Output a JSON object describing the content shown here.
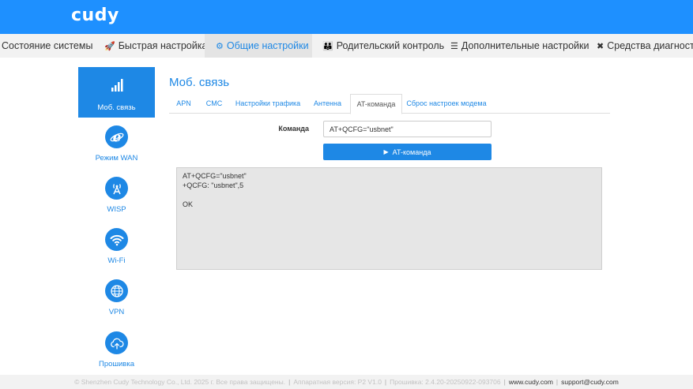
{
  "brand": {
    "logo": "cudy"
  },
  "nav": {
    "items": [
      {
        "label": "Состояние системы",
        "icon": ""
      },
      {
        "label": "Быстрая настройка",
        "icon": "rocket-icon"
      },
      {
        "label": "Общие настройки",
        "icon": "gear-icon"
      },
      {
        "label": "Родительский контроль",
        "icon": "family-icon"
      },
      {
        "label": "Дополнительные настройки",
        "icon": "sliders-icon"
      },
      {
        "label": "Средства диагностики",
        "icon": "tools-icon"
      }
    ],
    "active_index": 2
  },
  "sidebar": {
    "items": [
      {
        "label": "Моб. связь",
        "icon": "signal-bars-icon"
      },
      {
        "label": "Режим WAN",
        "icon": "internet-explorer-icon"
      },
      {
        "label": "WISP",
        "icon": "antenna-icon"
      },
      {
        "label": "Wi-Fi",
        "icon": "wifi-icon"
      },
      {
        "label": "VPN",
        "icon": "globe-icon"
      },
      {
        "label": "Прошивка",
        "icon": "cloud-upload-icon"
      }
    ],
    "active_index": 0
  },
  "main": {
    "title": "Моб. связь",
    "tabs": [
      "APN",
      "СМС",
      "Настройки трафика",
      "Антенна",
      "AT-команда",
      "Сброс настроек модема"
    ],
    "active_tab": 4,
    "command": {
      "label": "Команда",
      "value": "AT+QCFG=\"usbnet\"",
      "button_label": "AT-команда"
    },
    "output_lines": [
      "AT+QCFG=\"usbnet\"",
      "+QCFG: \"usbnet\",5",
      "",
      "OK"
    ]
  },
  "footer": {
    "copyright": "© Shenzhen Cudy Technology Co., Ltd. 2025 г. Все права защищены.",
    "hardware": "Аппаратная версия: P2 V1.0",
    "firmware": "Прошивка: 2.4.20-20250922-093706",
    "website": "www.cudy.com",
    "email": "support@cudy.com"
  },
  "colors": {
    "accent": "#1e88e5",
    "topbar": "#1e90ff",
    "output_bg": "#e6e6e6"
  }
}
